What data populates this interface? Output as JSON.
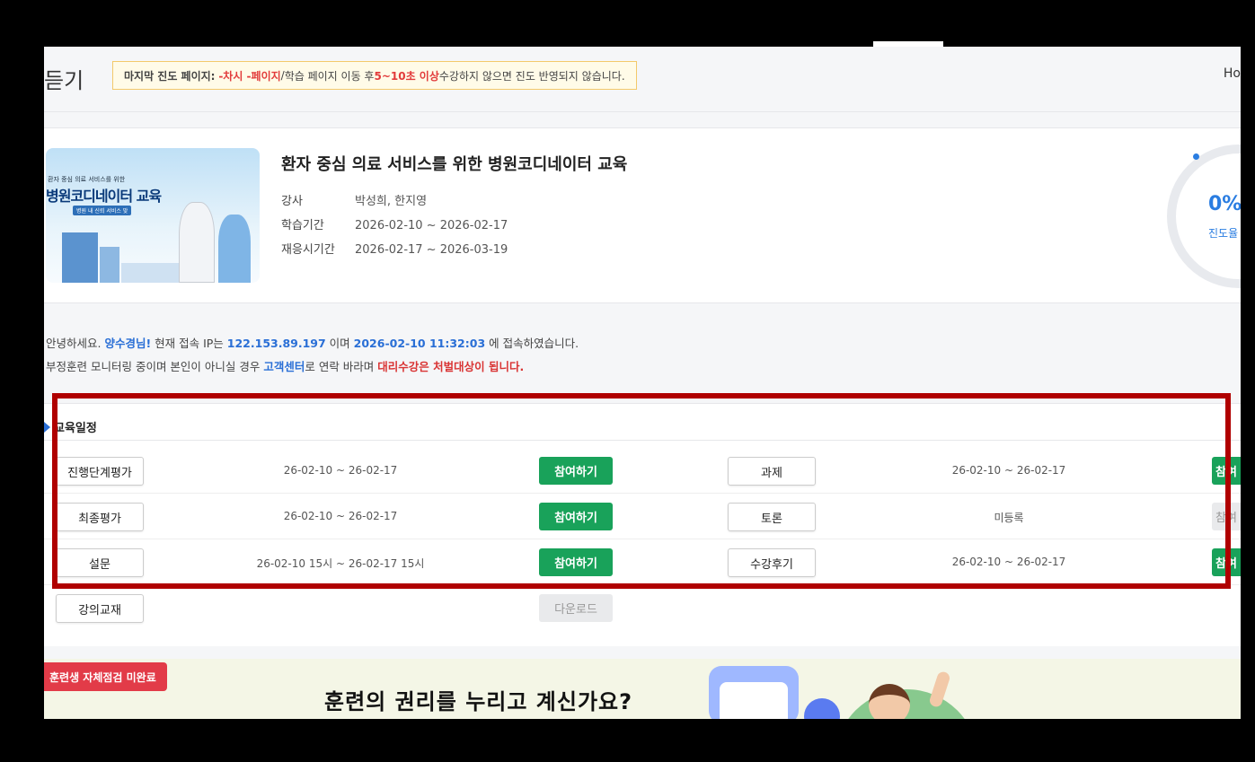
{
  "header": {
    "title": "듣기",
    "notice": {
      "label": "마지막 진도 페이지:",
      "last_page": "-차시 -페이지",
      "slash": " / ",
      "desc1": "학습 페이지 이동 후 ",
      "seconds": "5~10초 이상",
      "desc2": " 수강하지 않으면 진도 반영되지 않습니다."
    },
    "right_text": "Ho"
  },
  "course": {
    "thumb_small": "환자 중심 의료 서비스를 위한",
    "thumb_title": "병원코디네이터 교육",
    "thumb_tag": "병원 내 신뢰 서비스 맞",
    "title": "환자 중심 의료 서비스를 위한 병원코디네이터 교육",
    "instructor_label": "강사",
    "instructor": "박성희, 한지영",
    "period_label": "학습기간",
    "period": "2026-02-10 ~ 2026-02-17",
    "review_label": "재응시기간",
    "review_period": "2026-02-17 ~ 2026-03-19",
    "progress_value": "0%",
    "progress_label": "진도율"
  },
  "greeting": {
    "p1": "안녕하세요. ",
    "name": "양수경님!",
    "p2": " 현재 접속 IP는 ",
    "ip": "122.153.89.197",
    "p3": " 이며 ",
    "datetime": "2026-02-10 11:32:03",
    "p4": " 에 접속하였습니다.",
    "l2a": "부정훈련 모니터링 중이며 본인이 아니실 경우 ",
    "support": "고객센터",
    "l2b": "로 연락 바라며 ",
    "warn": "대리수강은 처벌대상이 됩니다."
  },
  "schedule": {
    "heading": "교육일정",
    "rows": [
      {
        "left_label": "진행단계평가",
        "left_dates": "26-02-10 ~ 26-02-17",
        "left_action": "참여하기",
        "right_label": "과제",
        "right_dates": "26-02-10 ~ 26-02-17",
        "right_action": "참여"
      },
      {
        "left_label": "최종평가",
        "left_dates": "26-02-10 ~ 26-02-17",
        "left_action": "참여하기",
        "right_label": "토론",
        "right_dates": "미등록",
        "right_action": "참여"
      },
      {
        "left_label": "설문",
        "left_dates": "26-02-10 15시 ~ 26-02-17 15시",
        "left_action": "참여하기",
        "right_label": "수강후기",
        "right_dates": "26-02-10 ~ 26-02-17",
        "right_action": "참여"
      },
      {
        "left_label": "강의교재",
        "left_action": "다운로드"
      }
    ]
  },
  "banner": {
    "badge": "훈련생 자체점검 미완료",
    "headline": "훈련의 권리를 누리고 계신가요?"
  },
  "colors": {
    "accent_blue": "#2a6fd6",
    "green": "#19a25a",
    "red": "#d93434",
    "highlight_border": "#b00000"
  }
}
